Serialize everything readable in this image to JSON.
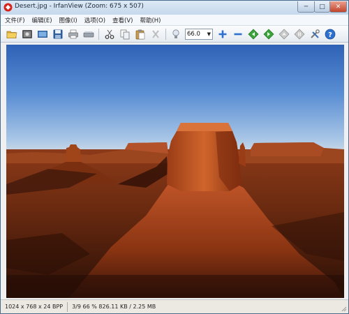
{
  "window": {
    "title": "Desert.jpg - IrfanView (Zoom: 675 x 507)",
    "controls": {
      "minimize": "─",
      "maximize": "□",
      "close": "✕"
    }
  },
  "menu": {
    "items": [
      "文件(F)",
      "编辑(E)",
      "图像(I)",
      "选项(O)",
      "查看(V)",
      "帮助(H)"
    ]
  },
  "toolbar": {
    "zoom_value": "66.0",
    "buttons": [
      "open-folder-icon",
      "slideshow-icon",
      "thumbnails-icon",
      "save-icon",
      "print-icon",
      "scanner-icon",
      "cut-icon",
      "copy-icon",
      "paste-icon",
      "delete-icon",
      "bulb-icon",
      "zoom-in-icon",
      "zoom-out-icon",
      "previous-icon",
      "next-icon",
      "up-arrow-icon",
      "pause-icon",
      "tools-icon",
      "help-icon"
    ]
  },
  "image": {
    "name": "Desert.jpg",
    "alt": "Desert landscape with red sandstone buttes under a blue sky"
  },
  "status": {
    "dimensions": "1024 x 768 x 24 BPP",
    "info": "3/9  66 %  826.11 KB / 2.25 MB"
  },
  "colors": {
    "sky_top": "#3a6fc0",
    "sky_horizon": "#bcd3ea",
    "rock": "#b9491c",
    "shadow": "#2a1008",
    "title_bar": "#c5d8ec"
  }
}
